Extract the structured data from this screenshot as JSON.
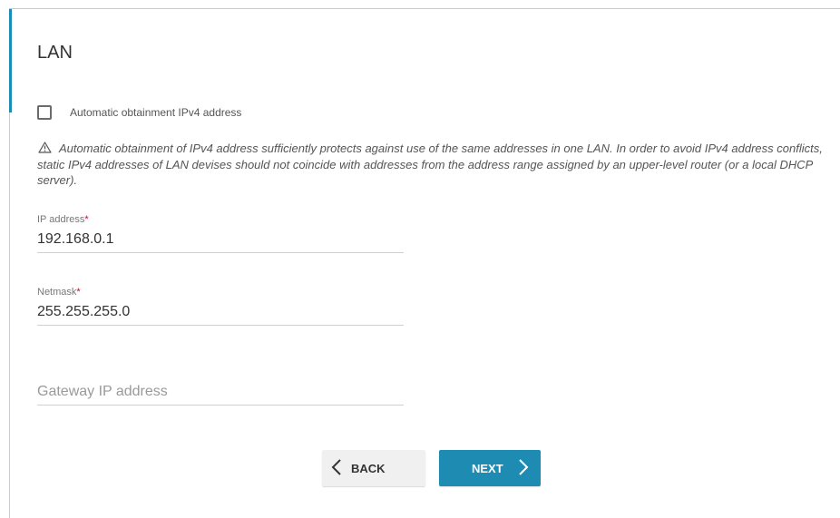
{
  "page": {
    "title": "LAN"
  },
  "auto_ipv4": {
    "label": "Automatic obtainment IPv4 address",
    "checked": false
  },
  "warning": {
    "icon": "warning-triangle-icon",
    "text": "Automatic obtainment of IPv4 address sufficiently protects against use of the same addresses in one LAN. In order to avoid IPv4 address conflicts, static IPv4 addresses of LAN devises should not coincide with addresses from the address range assigned by an upper-level router (or a local DHCP server)."
  },
  "fields": {
    "ip_address": {
      "label": "IP address",
      "required_mark": "*",
      "value": "192.168.0.1"
    },
    "netmask": {
      "label": "Netmask",
      "required_mark": "*",
      "value": "255.255.255.0"
    },
    "gateway": {
      "placeholder": "Gateway IP address",
      "value": ""
    }
  },
  "buttons": {
    "back": {
      "label": "BACK",
      "icon": "chevron-left-icon"
    },
    "next": {
      "label": "NEXT",
      "icon": "chevron-right-icon"
    }
  },
  "colors": {
    "accent": "#1e8bb3",
    "required": "#d0021b"
  }
}
